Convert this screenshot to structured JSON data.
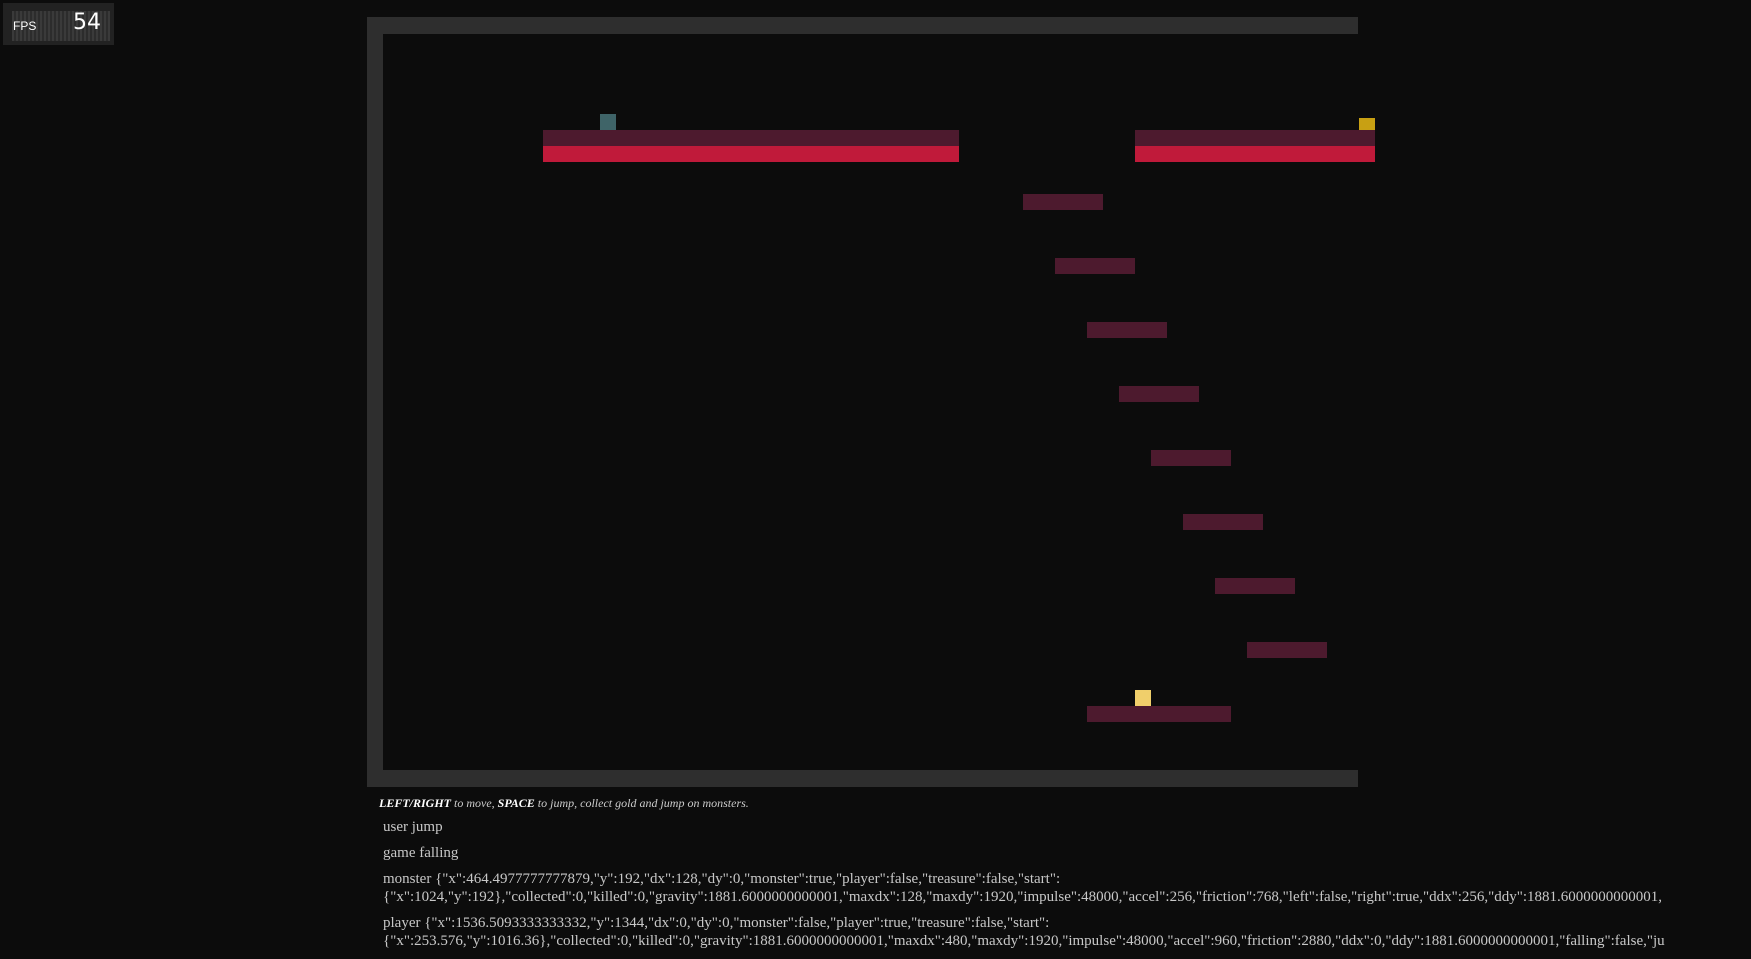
{
  "fps": {
    "label": "FPS",
    "value": "54"
  },
  "instructions": {
    "left_right": "LEFT/RIGHT",
    "to_move": " to move, ",
    "space": "SPACE",
    "rest": " to jump, collect gold and jump on monsters."
  },
  "log": {
    "line1": "user jump",
    "line2": "game falling",
    "monster": "monster {\"x\":464.4977777777879,\"y\":192,\"dx\":128,\"dy\":0,\"monster\":true,\"player\":false,\"treasure\":false,\"start\": {\"x\":1024,\"y\":192},\"collected\":0,\"killed\":0,\"gravity\":1881.6000000000001,\"maxdx\":128,\"maxdy\":1920,\"impulse\":48000,\"accel\":256,\"friction\":768,\"left\":false,\"right\":true,\"ddx\":256,\"ddy\":1881.6000000000001,",
    "player": "player {\"x\":1536.5093333333332,\"y\":1344,\"dx\":0,\"dy\":0,\"monster\":false,\"player\":true,\"treasure\":false,\"start\": {\"x\":253.576,\"y\":1016.36},\"collected\":0,\"killed\":0,\"gravity\":1881.6000000000001,\"maxdx\":480,\"maxdy\":1920,\"impulse\":48000,\"accel\":960,\"friction\":2880,\"ddx\":0,\"ddy\":1881.6000000000001,\"falling\":false,\"ju"
  },
  "colors": {
    "platform": "#4d1a2e",
    "lava": "#c01a3a",
    "monster": "#3f6468",
    "player": "#f0cf6b",
    "gold": "#c8a013"
  }
}
